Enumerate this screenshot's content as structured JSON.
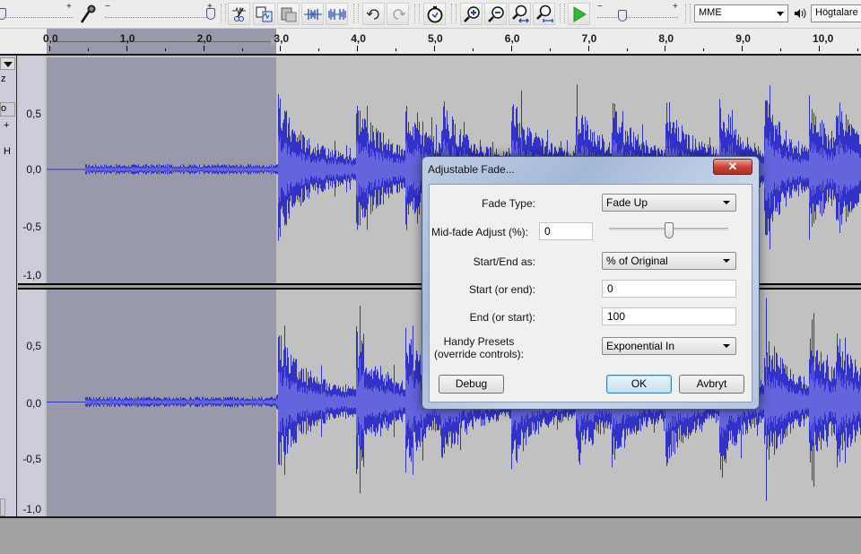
{
  "toolbar": {
    "mic_slider": {
      "minus": "−",
      "plus": "+",
      "value_fraction": 1.0
    },
    "out_slider": {
      "plus": "+",
      "value_fraction": 0.0
    },
    "tools": [
      {
        "name": "trim-audio-icon"
      },
      {
        "name": "silence-audio-icon"
      },
      {
        "name": "paste-icon"
      },
      {
        "name": "trim-outside-icon"
      },
      {
        "name": "silence-selection-icon"
      },
      {
        "name": "undo-icon"
      },
      {
        "name": "redo-icon"
      },
      {
        "name": "sync-lock-icon"
      },
      {
        "name": "zoom-in-icon"
      },
      {
        "name": "zoom-out-icon"
      },
      {
        "name": "fit-selection-icon"
      },
      {
        "name": "fit-project-icon"
      },
      {
        "name": "play-at-speed-icon"
      }
    ],
    "speed_slider": {
      "minus": "−",
      "plus": "+",
      "value_fraction": 0.33
    },
    "host_select": "MME",
    "output_device": "Högtalare"
  },
  "ruler": {
    "ticks": [
      "0,0",
      "1,0",
      "2,0",
      "3,0",
      "4,0",
      "5,0",
      "6,0",
      "7,0",
      "8,0",
      "9,0",
      "10,0"
    ],
    "selection": {
      "start": "0,0",
      "end": "3,0"
    }
  },
  "track_panel": {
    "labels": [
      "z",
      "o",
      "+",
      "H"
    ]
  },
  "tracks": [
    {
      "scale": [
        "0,5",
        "0,0",
        "-0,5",
        "-1,0"
      ]
    },
    {
      "scale": [
        "0,5",
        "0,0",
        "-0,5",
        "-1,0"
      ]
    }
  ],
  "dialog": {
    "title": "Adjustable Fade...",
    "close": "✕",
    "fade_type_label": "Fade Type:",
    "fade_type_value": "Fade Up",
    "mid_fade_label": "Mid-fade Adjust (%):",
    "mid_fade_value": "0",
    "mid_fade_slider_fraction": 0.5,
    "start_end_label": "Start/End as:",
    "start_end_value": "% of Original",
    "start_label": "Start (or end):",
    "start_value": "0",
    "end_label": "End (or start):",
    "end_value": "100",
    "presets_label_1": "Handy Presets",
    "presets_label_2": "(override controls):",
    "presets_value": "Exponential In",
    "debug_button": "Debug",
    "ok_button": "OK",
    "cancel_button": "Avbryt"
  },
  "colors": {
    "waveform": "#3232c8",
    "waveform_rms": "#6464dc",
    "selection": "#9899ab",
    "background": "#c1c1c1"
  }
}
